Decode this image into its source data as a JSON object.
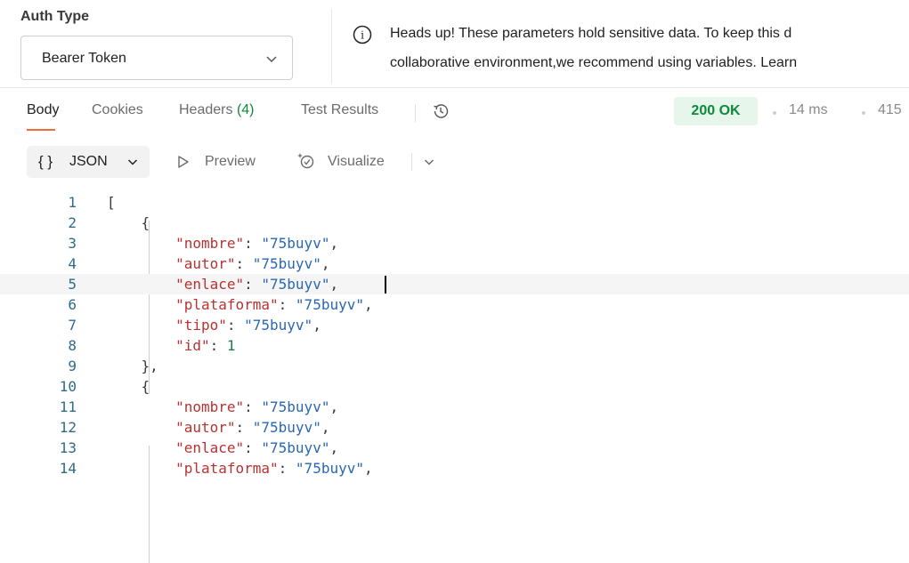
{
  "auth": {
    "label": "Auth Type",
    "selected": "Bearer Token",
    "info_line1": "Heads up! These parameters hold sensitive data. To keep this d",
    "info_line2": "collaborative environment,we recommend using variables. Learn"
  },
  "tabs": {
    "body": "Body",
    "cookies": "Cookies",
    "headers": "Headers",
    "headers_count": "(4)",
    "test_results": "Test Results"
  },
  "status": {
    "code": "200 OK",
    "time": "14 ms",
    "size": "415"
  },
  "toolbar": {
    "braces": "{ }",
    "format": "JSON",
    "preview": "Preview",
    "visualize": "Visualize"
  },
  "icons": {
    "info": "info-icon",
    "history": "history-icon",
    "chevron": "chevron-down-icon",
    "preview": "play-outline-icon",
    "visualize": "visualize-icon"
  },
  "colors": {
    "status_green": "#0f8a3c",
    "status_bg": "#e6f6ea",
    "tab_accent": "#f26b3a",
    "json_key": "#b83232",
    "json_string": "#2a67b5",
    "json_number": "#1a7f4b",
    "line_number": "#2f6b8a"
  },
  "editor": {
    "active_line": 5,
    "lines": [
      {
        "n": "1",
        "tokens": [
          {
            "t": "[",
            "c": "punct"
          }
        ]
      },
      {
        "n": "2",
        "tokens": [
          {
            "t": "    ",
            "c": "punct"
          },
          {
            "t": "{",
            "c": "punct"
          }
        ]
      },
      {
        "n": "3",
        "tokens": [
          {
            "t": "        ",
            "c": "punct"
          },
          {
            "t": "\"nombre\"",
            "c": "key"
          },
          {
            "t": ": ",
            "c": "punct"
          },
          {
            "t": "\"75buyv\"",
            "c": "str"
          },
          {
            "t": ",",
            "c": "punct"
          }
        ]
      },
      {
        "n": "4",
        "tokens": [
          {
            "t": "        ",
            "c": "punct"
          },
          {
            "t": "\"autor\"",
            "c": "key"
          },
          {
            "t": ": ",
            "c": "punct"
          },
          {
            "t": "\"75buyv\"",
            "c": "str"
          },
          {
            "t": ",",
            "c": "punct"
          }
        ]
      },
      {
        "n": "5",
        "tokens": [
          {
            "t": "        ",
            "c": "punct"
          },
          {
            "t": "\"enlace\"",
            "c": "key"
          },
          {
            "t": ": ",
            "c": "punct"
          },
          {
            "t": "\"75buyv\"",
            "c": "str"
          },
          {
            "t": ",",
            "c": "punct"
          }
        ]
      },
      {
        "n": "6",
        "tokens": [
          {
            "t": "        ",
            "c": "punct"
          },
          {
            "t": "\"plataforma\"",
            "c": "key"
          },
          {
            "t": ": ",
            "c": "punct"
          },
          {
            "t": "\"75buyv\"",
            "c": "str"
          },
          {
            "t": ",",
            "c": "punct"
          }
        ]
      },
      {
        "n": "7",
        "tokens": [
          {
            "t": "        ",
            "c": "punct"
          },
          {
            "t": "\"tipo\"",
            "c": "key"
          },
          {
            "t": ": ",
            "c": "punct"
          },
          {
            "t": "\"75buyv\"",
            "c": "str"
          },
          {
            "t": ",",
            "c": "punct"
          }
        ]
      },
      {
        "n": "8",
        "tokens": [
          {
            "t": "        ",
            "c": "punct"
          },
          {
            "t": "\"id\"",
            "c": "key"
          },
          {
            "t": ": ",
            "c": "punct"
          },
          {
            "t": "1",
            "c": "num"
          }
        ]
      },
      {
        "n": "9",
        "tokens": [
          {
            "t": "    ",
            "c": "punct"
          },
          {
            "t": "},",
            "c": "punct"
          }
        ]
      },
      {
        "n": "10",
        "tokens": [
          {
            "t": "    ",
            "c": "punct"
          },
          {
            "t": "{",
            "c": "punct"
          }
        ]
      },
      {
        "n": "11",
        "tokens": [
          {
            "t": "        ",
            "c": "punct"
          },
          {
            "t": "\"nombre\"",
            "c": "key"
          },
          {
            "t": ": ",
            "c": "punct"
          },
          {
            "t": "\"75buyv\"",
            "c": "str"
          },
          {
            "t": ",",
            "c": "punct"
          }
        ]
      },
      {
        "n": "12",
        "tokens": [
          {
            "t": "        ",
            "c": "punct"
          },
          {
            "t": "\"autor\"",
            "c": "key"
          },
          {
            "t": ": ",
            "c": "punct"
          },
          {
            "t": "\"75buyv\"",
            "c": "str"
          },
          {
            "t": ",",
            "c": "punct"
          }
        ]
      },
      {
        "n": "13",
        "tokens": [
          {
            "t": "        ",
            "c": "punct"
          },
          {
            "t": "\"enlace\"",
            "c": "key"
          },
          {
            "t": ": ",
            "c": "punct"
          },
          {
            "t": "\"75buyv\"",
            "c": "str"
          },
          {
            "t": ",",
            "c": "punct"
          }
        ]
      },
      {
        "n": "14",
        "tokens": [
          {
            "t": "        ",
            "c": "punct"
          },
          {
            "t": "\"plataforma\"",
            "c": "key"
          },
          {
            "t": ": ",
            "c": "punct"
          },
          {
            "t": "\"75buyv\"",
            "c": "str"
          },
          {
            "t": ",",
            "c": "punct"
          }
        ]
      }
    ]
  }
}
